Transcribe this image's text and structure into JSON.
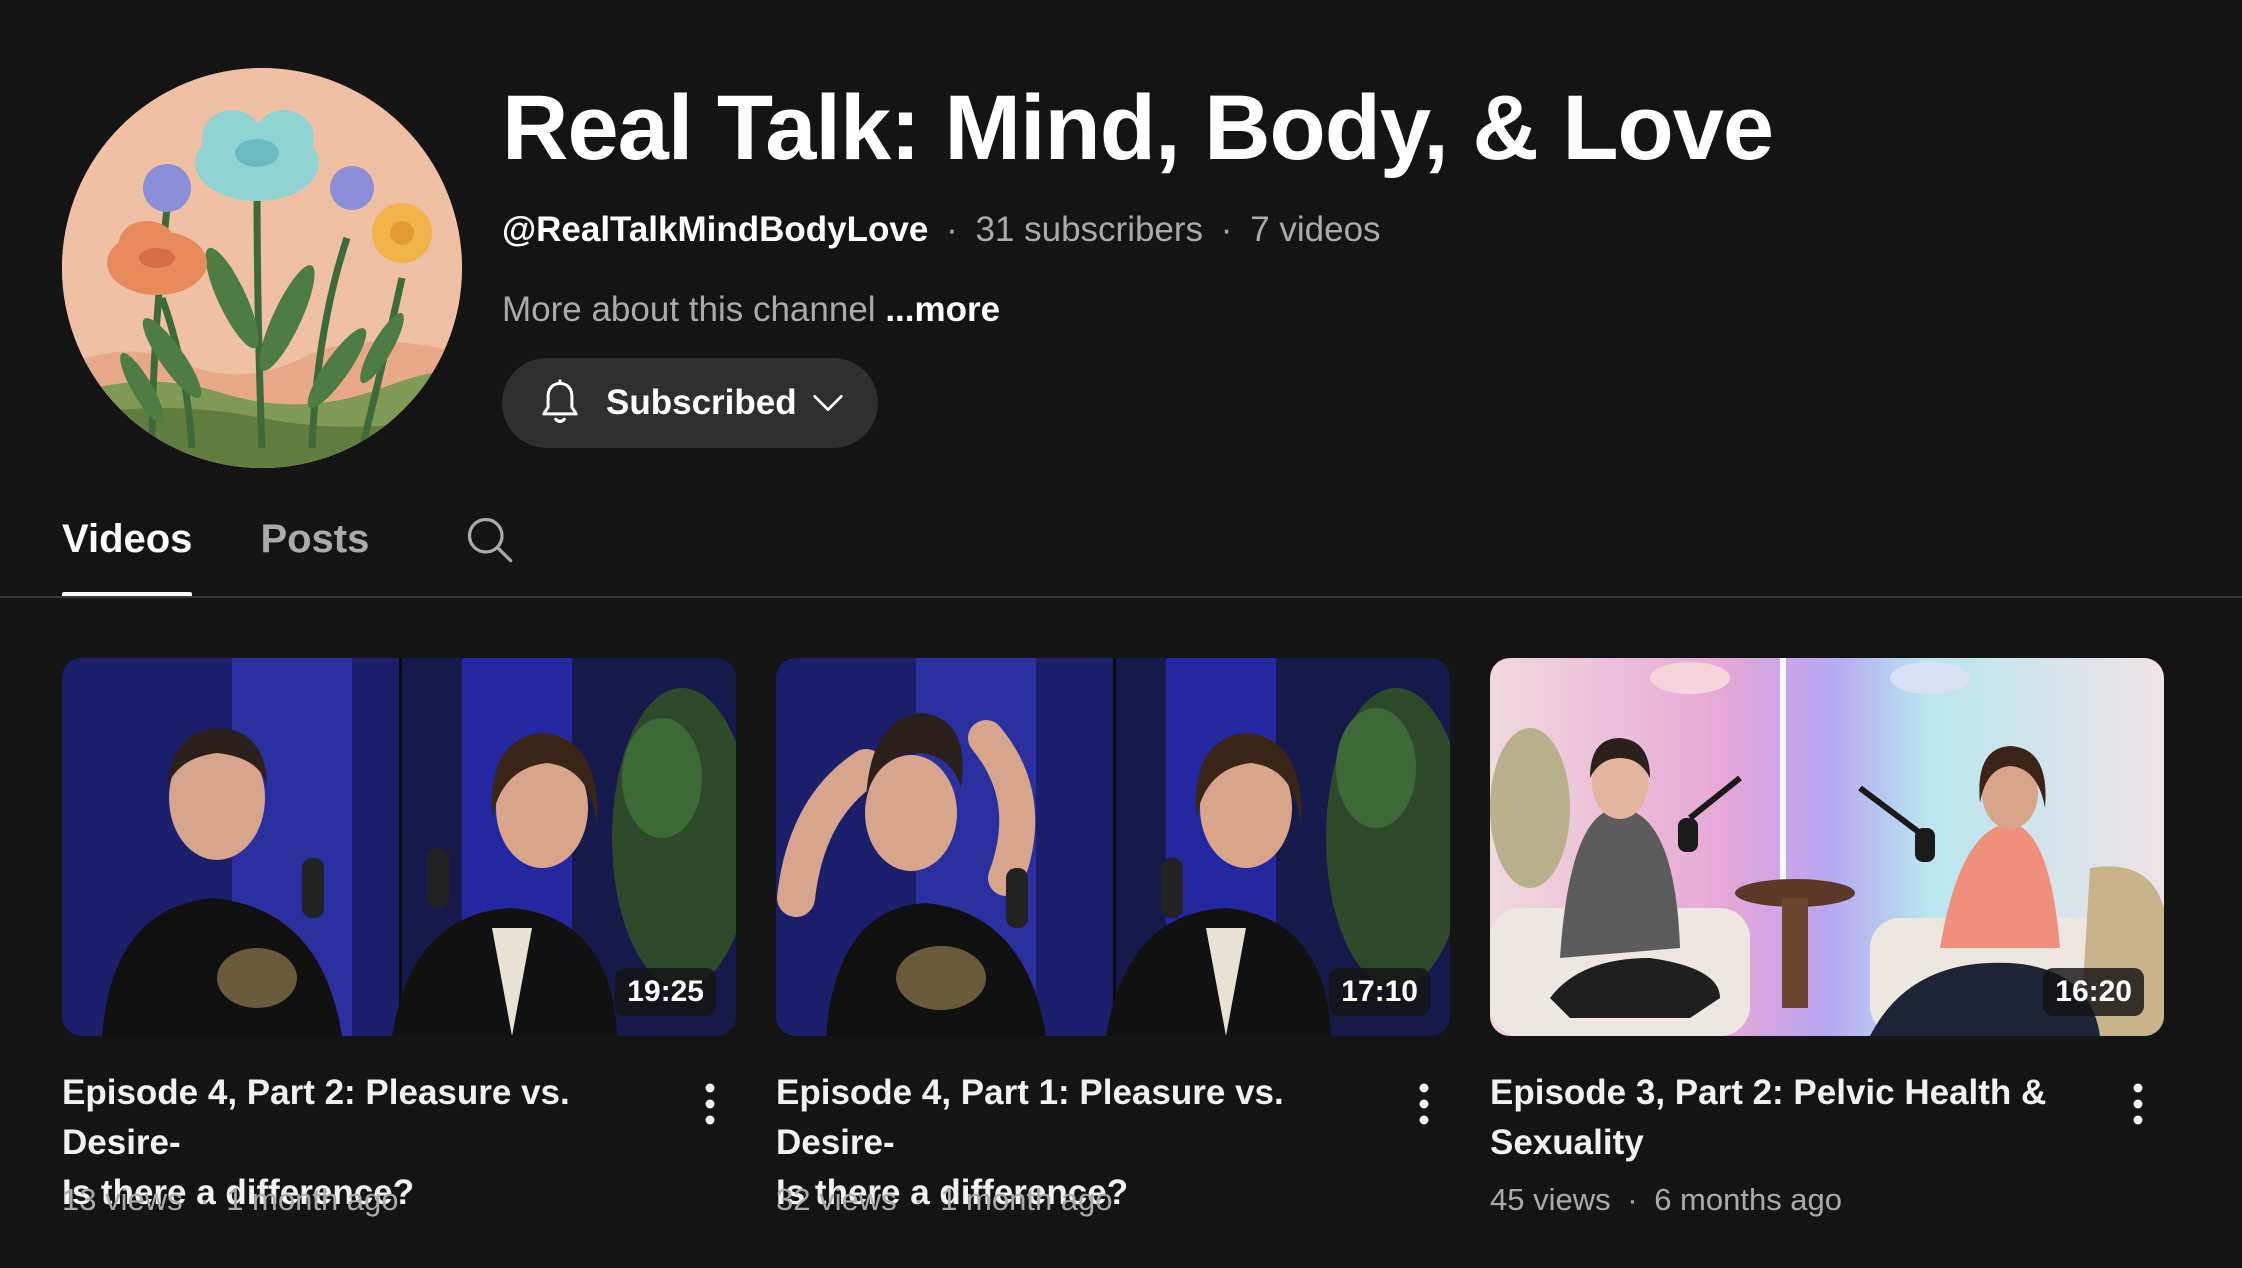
{
  "channel": {
    "title": "Real Talk: Mind, Body, & Love",
    "handle": "@RealTalkMindBodyLove",
    "subscribers": "31 subscribers",
    "videos_count": "7 videos",
    "separator": "·",
    "about_text": "More about this channel",
    "more_label": "...more",
    "subscribe_label": "Subscribed",
    "avatar_icon": "flower-illustration-avatar"
  },
  "tabs": [
    {
      "label": "Videos",
      "active": true
    },
    {
      "label": "Posts",
      "active": false
    }
  ],
  "videos": [
    {
      "title": "Episode 4, Part 2: Pleasure vs. Desire-Is there a difference?",
      "title_line1": "Episode 4, Part 2: Pleasure vs. Desire-",
      "title_line2": "Is there a difference?",
      "duration": "19:25",
      "views": "13 views",
      "age": "1 month ago"
    },
    {
      "title": "Episode 4, Part 1: Pleasure vs. Desire-Is there a difference?",
      "title_line1": "Episode 4, Part 1: Pleasure vs. Desire-",
      "title_line2": "Is there a difference?",
      "duration": "17:10",
      "views": "32 views",
      "age": "1 month ago"
    },
    {
      "title": "Episode 3, Part 2: Pelvic Health & Sexuality",
      "title_line1": "Episode 3, Part 2: Pelvic Health &",
      "title_line2": "Sexuality",
      "duration": "16:20",
      "views": "45 views",
      "age": "6 months ago"
    }
  ],
  "colors": {
    "background": "#141414",
    "subscribe_button": "#2f2f2f",
    "text_primary": "#f1f1f1",
    "text_secondary": "#aaaaaa"
  }
}
